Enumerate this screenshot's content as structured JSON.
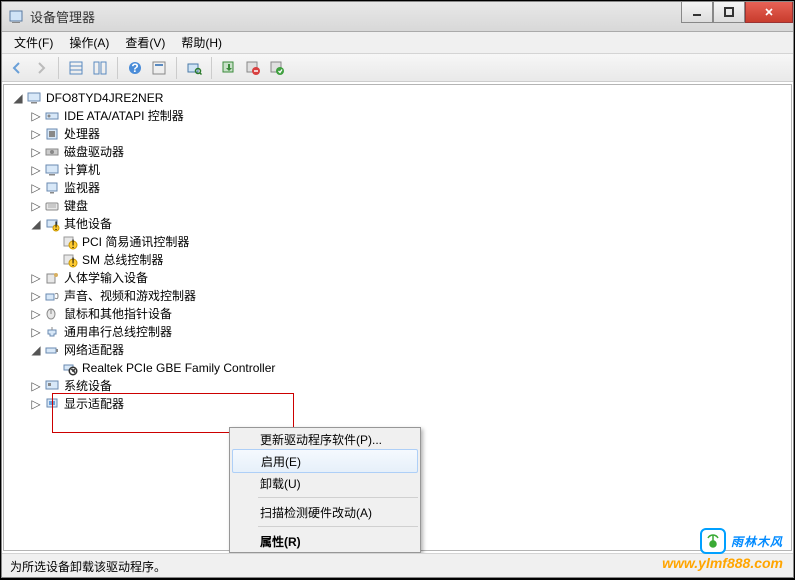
{
  "window": {
    "title": "设备管理器"
  },
  "menu": {
    "file": "文件(F)",
    "action": "操作(A)",
    "view": "查看(V)",
    "help": "帮助(H)"
  },
  "tree": {
    "root": "DFO8TYD4JRE2NER",
    "items": [
      "IDE ATA/ATAPI 控制器",
      "处理器",
      "磁盘驱动器",
      "计算机",
      "监视器",
      "键盘"
    ],
    "other_devices": {
      "label": "其他设备",
      "children": [
        "PCI 简易通讯控制器",
        "SM 总线控制器"
      ]
    },
    "more_items": [
      "人体学输入设备",
      "声音、视频和游戏控制器",
      "鼠标和其他指针设备",
      "通用串行总线控制器"
    ],
    "network": {
      "label": "网络适配器",
      "child": "Realtek PCIe GBE Family Controller"
    },
    "tail_items": [
      "系统设备",
      "显示适配器"
    ]
  },
  "context_menu": {
    "update": "更新驱动程序软件(P)...",
    "enable": "启用(E)",
    "uninstall": "卸载(U)",
    "scan": "扫描检测硬件改动(A)",
    "properties": "属性(R)"
  },
  "status": "为所选设备卸载该驱动程序。",
  "watermark": {
    "brand": "雨林木风",
    "url": "www.ylmf888.com"
  }
}
